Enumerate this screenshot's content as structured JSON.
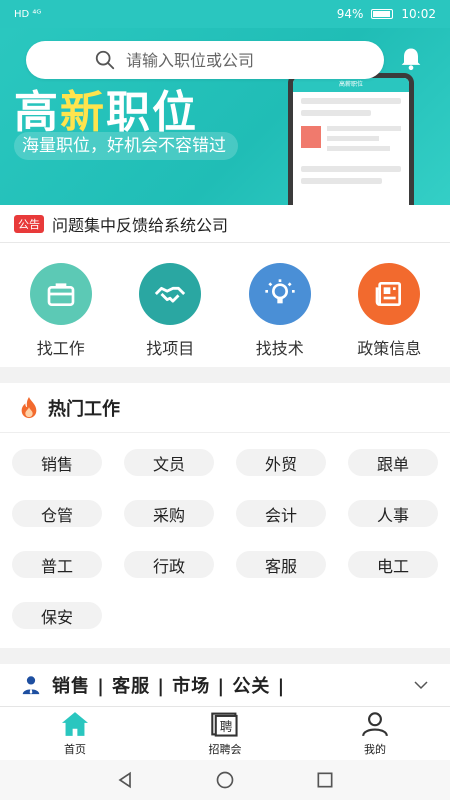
{
  "status_bar": {
    "left": "HD ⁴ᴳ",
    "battery": "94%",
    "time": "10:02"
  },
  "search": {
    "placeholder": "请输入职位或公司"
  },
  "banner": {
    "title_part1": "高",
    "title_highlight": "新",
    "title_part2": "职位",
    "subtitle": "海量职位，好机会不容错过",
    "phone_header": "高薪职位"
  },
  "notice": {
    "badge": "公告",
    "text": "问题集中反馈给系统公司"
  },
  "categories": [
    {
      "label": "找工作",
      "icon": "briefcase-icon",
      "color": "#5cc9b5"
    },
    {
      "label": "找项目",
      "icon": "handshake-icon",
      "color": "#2aa7a2"
    },
    {
      "label": "找技术",
      "icon": "lightbulb-icon",
      "color": "#4a8fd6"
    },
    {
      "label": "政策信息",
      "icon": "newspaper-icon",
      "color": "#f26a2e"
    }
  ],
  "hot_jobs": {
    "title": "热门工作",
    "tags": [
      "销售",
      "文员",
      "外贸",
      "跟单",
      "仓管",
      "采购",
      "会计",
      "人事",
      "普工",
      "行政",
      "客服",
      "电工",
      "保安"
    ]
  },
  "sales_strip": {
    "text": "销售 | 客服 | 市场 | 公关 |"
  },
  "bottom_nav": [
    {
      "label": "首页",
      "icon": "home-icon",
      "active": true
    },
    {
      "label": "招聘会",
      "icon": "job-fair-icon",
      "active": false
    },
    {
      "label": "我的",
      "icon": "user-icon",
      "active": false
    }
  ],
  "colors": {
    "primary": "#2ac6bf",
    "highlight": "#ffe44d",
    "badge": "#e83a3a"
  }
}
